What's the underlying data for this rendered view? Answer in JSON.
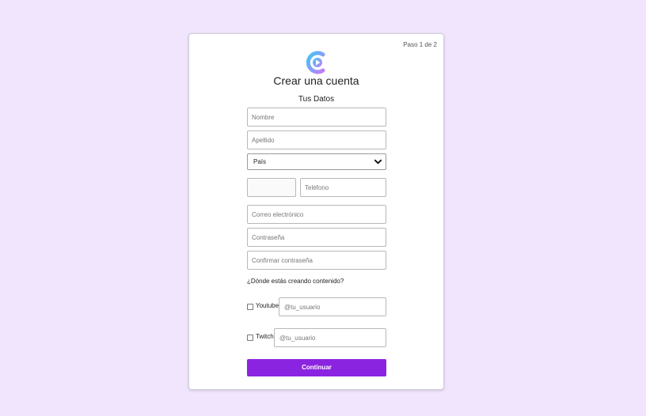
{
  "step_label": "Paso 1 de 2",
  "logo": {
    "icon": "play-circle-logo",
    "gradient": [
      "#3fc7f7",
      "#c47cf7"
    ]
  },
  "title": "Crear una cuenta",
  "section_title": "Tus Datos",
  "fields": {
    "first_name_placeholder": "Nombre",
    "last_name_placeholder": "Apellido",
    "country_selected": "País",
    "phone_code_value": "",
    "phone_placeholder": "Teléfono",
    "email_placeholder": "Correo electrónico",
    "password_placeholder": "Contraseña",
    "confirm_password_placeholder": "Confirmar contraseña"
  },
  "platforms_question": "¿Dónde estás creando contenido?",
  "platforms": [
    {
      "label": "Youtube",
      "placeholder": "@tu_usuario",
      "checked": false
    },
    {
      "label": "Twitch",
      "placeholder": "@tu_usuario",
      "checked": false
    }
  ],
  "continue_label": "Continuar",
  "colors": {
    "background": "#f1e4fd",
    "accent": "#8b24e0"
  }
}
